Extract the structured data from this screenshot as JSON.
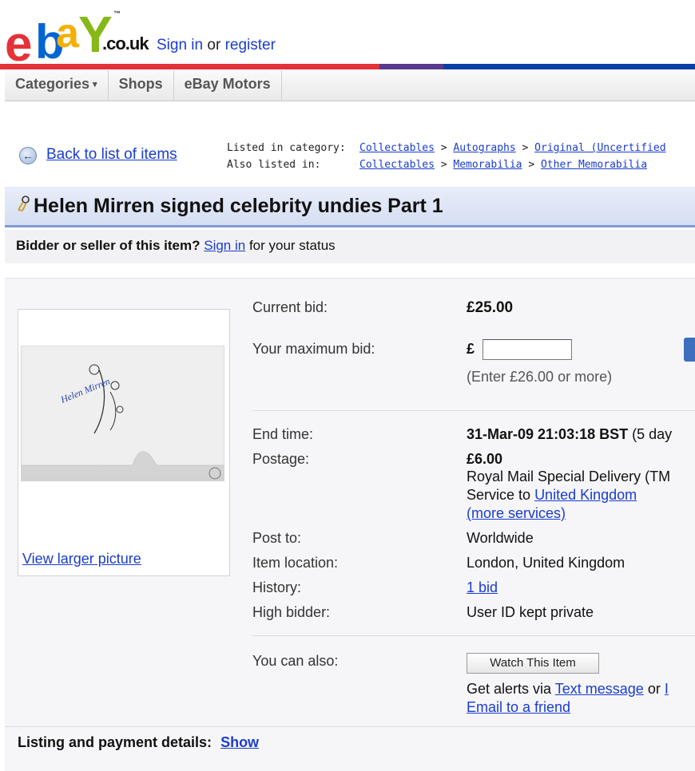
{
  "header": {
    "logo_letters": [
      "e",
      "b",
      "a",
      "Y"
    ],
    "logo_domain": ".co.uk",
    "logo_tm": "™",
    "signin_link": "Sign in",
    "signin_or": " or ",
    "register_link": "register"
  },
  "brand_colors": {
    "red": "#e53238",
    "blue": "#0064d2",
    "yellow": "#f5af02",
    "green": "#86b817",
    "link": "#1a3ccf"
  },
  "nav": {
    "categories": "Categories",
    "categories_caret": "▾",
    "shops": "Shops",
    "motors": "eBay Motors"
  },
  "breadcrumbs": {
    "back_icon": "left-arrow-icon",
    "back_label": "Back to list of items",
    "listed_label": "Listed in category:",
    "listed_path": [
      "Collectables",
      "Autographs",
      "Original (Uncertified"
    ],
    "also_label": "Also listed in:",
    "also_path": [
      "Collectables",
      "Memorabilia",
      "Other Memorabilia"
    ],
    "separator": ">"
  },
  "item": {
    "title": "Helen Mirren signed celebrity undies Part 1",
    "status_prefix": "Bidder or seller of this item?",
    "status_link": "Sign in",
    "status_suffix": "for your status",
    "photo_caption": "Helen Mirren",
    "view_larger": "View larger picture"
  },
  "details": {
    "current_bid_label": "Current bid:",
    "current_bid_value": "£25.00",
    "max_bid_label": "Your maximum bid:",
    "currency_symbol": "£",
    "max_bid_input_value": "",
    "max_bid_hint": "(Enter £26.00 or more)",
    "end_time_label": "End time:",
    "end_time_value": "31-Mar-09 21:03:18 BST",
    "end_time_extra": "(5 day",
    "postage_label": "Postage:",
    "postage_value": "£6.00",
    "postage_service": "Royal Mail Special Delivery (TM",
    "postage_service_to": "Service to",
    "postage_country_link": "United Kingdom",
    "more_services_link": "(more services)",
    "post_to_label": "Post to:",
    "post_to_value": "Worldwide",
    "location_label": "Item location:",
    "location_value": "London, United Kingdom",
    "history_label": "History:",
    "history_link": "1 bid",
    "high_bidder_label": "High bidder:",
    "high_bidder_value": "User ID kept private",
    "also_label": "You can also:",
    "watch_button": "Watch This Item",
    "alerts_prefix": "Get alerts via",
    "alerts_text_link": "Text message",
    "alerts_or": "or",
    "alerts_cut": "I",
    "email_friend_link": "Email to a friend"
  },
  "listing": {
    "label": "Listing and payment details:",
    "show_link": "Show"
  }
}
